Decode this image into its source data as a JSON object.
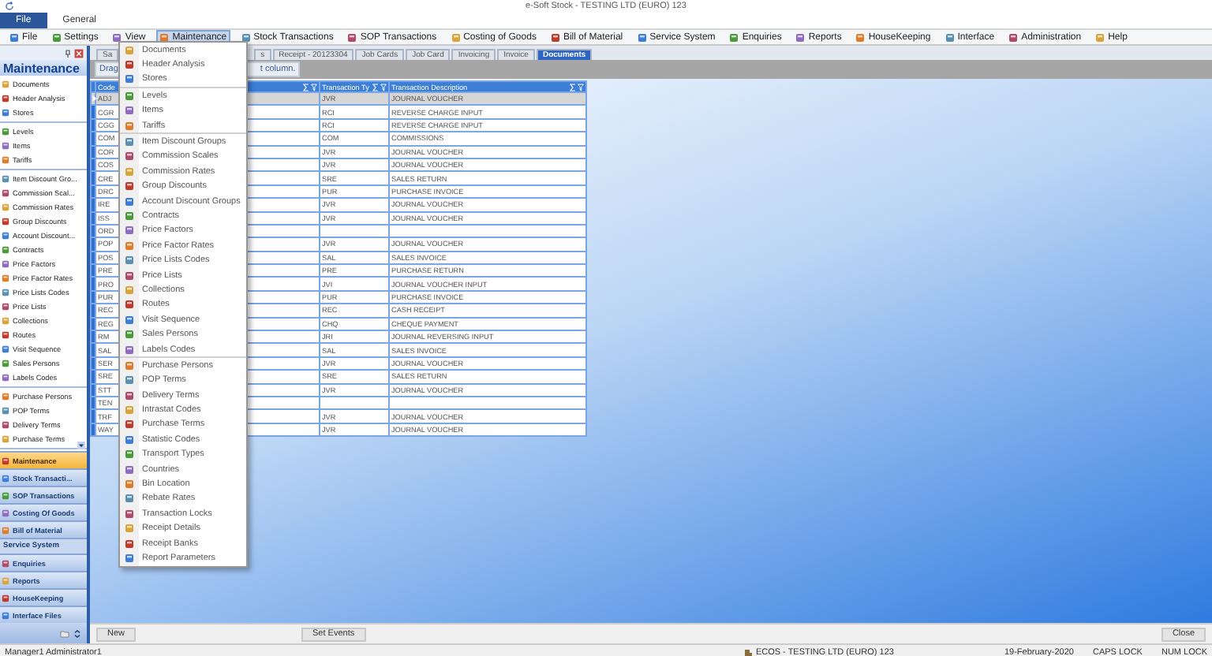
{
  "window": {
    "title": "e-Soft Stock - TESTING LTD (EURO) 123"
  },
  "ribbon_tabs": [
    {
      "label": "File",
      "selected": true
    },
    {
      "label": "General",
      "selected": false
    }
  ],
  "menu_bar": [
    {
      "label": "File",
      "selected": false
    },
    {
      "label": "Settings",
      "selected": false
    },
    {
      "label": "View",
      "selected": false
    },
    {
      "label": "Maintenance",
      "selected": true
    },
    {
      "label": "Stock Transactions",
      "selected": false
    },
    {
      "label": "SOP Transactions",
      "selected": false
    },
    {
      "label": "Costing of Goods",
      "selected": false
    },
    {
      "label": "Bill of Material",
      "selected": false
    },
    {
      "label": "Service System",
      "selected": false
    },
    {
      "label": "Enquiries",
      "selected": false
    },
    {
      "label": "Reports",
      "selected": false
    },
    {
      "label": "HouseKeeping",
      "selected": false
    },
    {
      "label": "Interface",
      "selected": false
    },
    {
      "label": "Administration",
      "selected": false
    },
    {
      "label": "Help",
      "selected": false
    }
  ],
  "dropdown_menu": {
    "groups": [
      {
        "items": [
          "Documents",
          "Header Analysis",
          "Stores"
        ]
      },
      {
        "items": [
          "Levels",
          "Items",
          "Tariffs"
        ]
      },
      {
        "items": [
          "Item Discount Groups",
          "Commission Scales",
          "Commission Rates",
          "Group Discounts",
          "Account Discount Groups",
          "Contracts",
          "Price Factors",
          "Price Factor Rates",
          "Price Lists Codes",
          "Price Lists",
          "Collections",
          "Routes",
          "Visit Sequence",
          "Sales Persons",
          "Labels Codes"
        ]
      },
      {
        "items": [
          "Purchase Persons",
          "POP Terms",
          "Delivery Terms",
          "Intrastat Codes",
          "Purchase Terms",
          "Statistic Codes",
          "Transport Types",
          "Countries",
          "Bin Location",
          "Rebate Rates",
          "Transaction Locks",
          "Receipt Details",
          "Receipt Banks",
          "Report Parameters"
        ]
      }
    ]
  },
  "sidebar": {
    "title": "Maintenance",
    "groups": [
      {
        "items": [
          "Documents",
          "Header Analysis",
          "Stores"
        ]
      },
      {
        "items": [
          "Levels",
          "Items",
          "Tariffs"
        ]
      },
      {
        "items": [
          "Item Discount Gro...",
          "Commission Scal...",
          "Commission Rates",
          "Group Discounts",
          "Account Discount...",
          "Contracts",
          "Price Factors",
          "Price Factor Rates",
          "Price Lists Codes",
          "Price Lists",
          "Collections",
          "Routes",
          "Visit Sequence",
          "Sales Persons",
          "Labels Codes"
        ]
      },
      {
        "items": [
          "Purchase Persons",
          "POP Terms",
          "Delivery Terms",
          "Purchase Terms"
        ]
      }
    ],
    "nav": [
      {
        "kind": "button",
        "label": "Maintenance",
        "selected": true
      },
      {
        "kind": "button",
        "label": "Stock Transacti...",
        "selected": false
      },
      {
        "kind": "button",
        "label": "SOP Transactions",
        "selected": false
      },
      {
        "kind": "button",
        "label": "Costing Of Goods",
        "selected": false
      },
      {
        "kind": "button",
        "label": "Bill of Material",
        "selected": false
      },
      {
        "kind": "header",
        "label": "Service System"
      },
      {
        "kind": "button",
        "label": "Enquiries",
        "selected": false
      },
      {
        "kind": "button",
        "label": "Reports",
        "selected": false
      },
      {
        "kind": "button",
        "label": "HouseKeeping",
        "selected": false
      },
      {
        "kind": "button",
        "label": "Interface Files",
        "selected": false
      }
    ]
  },
  "document_tabs": [
    {
      "label": "Sa",
      "selected": false
    },
    {
      "label": "s",
      "selected": false
    },
    {
      "label": "Receipt - 20123304",
      "selected": false
    },
    {
      "label": "Job Cards",
      "selected": false
    },
    {
      "label": "Job Card",
      "selected": false
    },
    {
      "label": "Invoicing",
      "selected": false
    },
    {
      "label": "Invoice",
      "selected": false
    },
    {
      "label": "Documents",
      "selected": true
    }
  ],
  "group_panel": {
    "texts": [
      "Drag",
      "t column."
    ]
  },
  "table": {
    "columns": [
      "Code",
      "Transaction Ty",
      "Transaction Description"
    ],
    "rows": [
      {
        "code": "ADJ",
        "type": "JVR",
        "description": "JOURNAL VOUCHER",
        "selected": true
      },
      {
        "code": "CGR",
        "type": "RCI",
        "description": "REVERSE CHARGE INPUT",
        "selected": false
      },
      {
        "code": "CGG",
        "type": "RCI",
        "description": "REVERSE CHARGE INPUT",
        "selected": false
      },
      {
        "code": "COM",
        "type": "COM",
        "description": "COMMISSIONS",
        "selected": false
      },
      {
        "code": "COR",
        "type": "JVR",
        "description": "JOURNAL VOUCHER",
        "selected": false
      },
      {
        "code": "COS",
        "type": "JVR",
        "description": "JOURNAL VOUCHER",
        "selected": false
      },
      {
        "code": "CRE",
        "type": "SRE",
        "description": "SALES RETURN",
        "selected": false
      },
      {
        "code": "DRC",
        "type": "PUR",
        "description": "PURCHASE INVOICE",
        "selected": false
      },
      {
        "code": "IRE",
        "type": "JVR",
        "description": "JOURNAL VOUCHER",
        "selected": false
      },
      {
        "code": "ISS",
        "type": "JVR",
        "description": "JOURNAL VOUCHER",
        "selected": false
      },
      {
        "code": "ORD",
        "selected": false
      },
      {
        "code": "POP",
        "type": "JVR",
        "description": "JOURNAL VOUCHER",
        "selected": false
      },
      {
        "code": "POS",
        "type": "SAL",
        "description": "SALES INVOICE",
        "selected": false
      },
      {
        "code": "PRE",
        "type": "PRE",
        "description": "PURCHASE RETURN",
        "selected": false
      },
      {
        "code": "PRO",
        "type": "JVI",
        "description": "JOURNAL VOUCHER INPUT",
        "selected": false
      },
      {
        "code": "PUR",
        "type": "PUR",
        "description": "PURCHASE INVOICE",
        "selected": false
      },
      {
        "code": "REC",
        "type": "REC",
        "description": "CASH RECEIPT",
        "selected": false
      },
      {
        "code": "REG",
        "type": "CHQ",
        "description": "CHEQUE PAYMENT",
        "selected": false
      },
      {
        "code": "RM",
        "type": "JRI",
        "description": "JOURNAL REVERSING INPUT",
        "selected": false
      },
      {
        "code": "SAL",
        "type": "SAL",
        "description": "SALES INVOICE",
        "selected": false
      },
      {
        "code": "SER",
        "type": "JVR",
        "description": "JOURNAL VOUCHER",
        "selected": false
      },
      {
        "code": "SRE",
        "type": "SRE",
        "description": "SALES RETURN",
        "selected": false
      },
      {
        "code": "STT",
        "type": "JVR",
        "description": "JOURNAL VOUCHER",
        "selected": false
      },
      {
        "code": "TEN",
        "selected": false
      },
      {
        "code": "TRF",
        "type": "JVR",
        "description": "JOURNAL VOUCHER",
        "selected": false
      },
      {
        "code": "WAY",
        "type": "JVR",
        "description": "JOURNAL VOUCHER",
        "selected": false
      }
    ]
  },
  "buttons": {
    "left": [
      "New",
      "Set Events"
    ],
    "right": [
      "Close"
    ]
  },
  "status_bar": {
    "user": "Manager1 Administrator1",
    "company": "ECOS - TESTING LTD (EURO) 123",
    "date": "19-February-2020",
    "caps": "CAPS LOCK",
    "num": "NUM LOCK"
  }
}
